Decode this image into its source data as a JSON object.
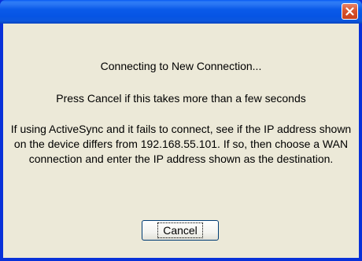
{
  "dialog": {
    "title": "",
    "message_line1": "Connecting to New Connection...",
    "message_line2": "Press Cancel if this takes more than a few seconds",
    "message_line3": "If using ActiveSync and it fails to connect, see if the IP address shown on the device differs from 192.168.55.101.  If so, then choose a WAN connection and enter the IP address shown as the destination.",
    "cancel_label": "Cancel",
    "close_icon": "close-icon"
  },
  "colors": {
    "titlebar": "#0a5ae9",
    "client_bg": "#ece9d8",
    "close_button": "#d8542f",
    "button_border": "#003c74"
  }
}
